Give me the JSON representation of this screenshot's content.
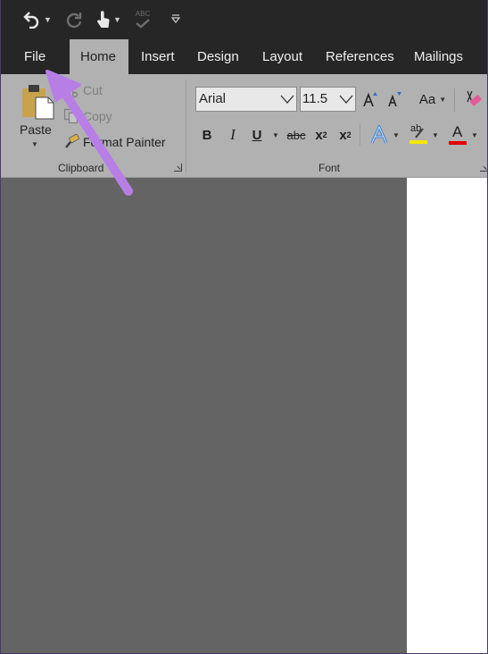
{
  "qat": {
    "undo_icon": "undo-icon",
    "redo_icon": "redo-icon",
    "touch_icon": "touch-mode-icon",
    "spelling_icon": "spelling-check-icon",
    "spelling_text": "ABC",
    "customize_icon": "customize-qat-icon"
  },
  "tabs": [
    {
      "label": "File"
    },
    {
      "label": "Home",
      "active": true
    },
    {
      "label": "Insert"
    },
    {
      "label": "Design"
    },
    {
      "label": "Layout"
    },
    {
      "label": "References"
    },
    {
      "label": "Mailings"
    }
  ],
  "clipboard": {
    "group_label": "Clipboard",
    "paste_label": "Paste",
    "cut_label": "Cut",
    "copy_label": "Copy",
    "format_painter_label": "Format Painter"
  },
  "font": {
    "group_label": "Font",
    "font_name": "Arial",
    "font_size": "11.5",
    "change_case_label": "Aa",
    "bold": "B",
    "italic": "I",
    "underline": "U",
    "strikethrough": "abc",
    "subscript_base": "x",
    "subscript_sub": "2",
    "superscript_base": "x",
    "superscript_sup": "2",
    "highlight_text": "ab",
    "font_color_text": "A"
  },
  "colors": {
    "accent_highlight": "#f7e600",
    "accent_font_color": "#e00000",
    "annotation_arrow": "#b77fe6",
    "text_effect": "#3e7fd0"
  }
}
